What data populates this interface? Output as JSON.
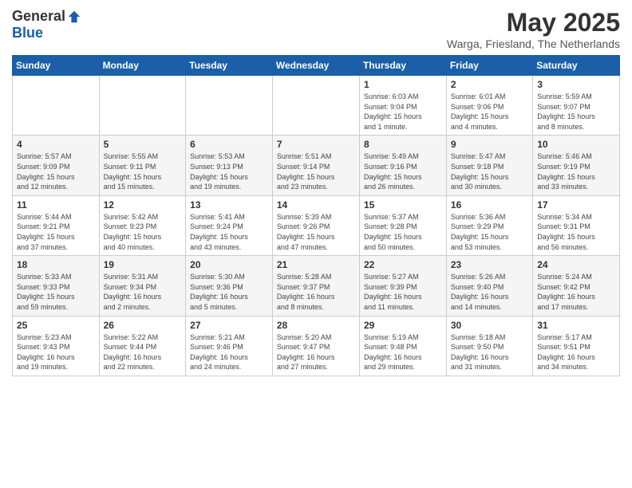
{
  "logo": {
    "general": "General",
    "blue": "Blue"
  },
  "title": "May 2025",
  "location": "Warga, Friesland, The Netherlands",
  "days_header": [
    "Sunday",
    "Monday",
    "Tuesday",
    "Wednesday",
    "Thursday",
    "Friday",
    "Saturday"
  ],
  "weeks": [
    [
      {
        "day": "",
        "info": ""
      },
      {
        "day": "",
        "info": ""
      },
      {
        "day": "",
        "info": ""
      },
      {
        "day": "",
        "info": ""
      },
      {
        "day": "1",
        "info": "Sunrise: 6:03 AM\nSunset: 9:04 PM\nDaylight: 15 hours\nand 1 minute."
      },
      {
        "day": "2",
        "info": "Sunrise: 6:01 AM\nSunset: 9:06 PM\nDaylight: 15 hours\nand 4 minutes."
      },
      {
        "day": "3",
        "info": "Sunrise: 5:59 AM\nSunset: 9:07 PM\nDaylight: 15 hours\nand 8 minutes."
      }
    ],
    [
      {
        "day": "4",
        "info": "Sunrise: 5:57 AM\nSunset: 9:09 PM\nDaylight: 15 hours\nand 12 minutes."
      },
      {
        "day": "5",
        "info": "Sunrise: 5:55 AM\nSunset: 9:11 PM\nDaylight: 15 hours\nand 15 minutes."
      },
      {
        "day": "6",
        "info": "Sunrise: 5:53 AM\nSunset: 9:13 PM\nDaylight: 15 hours\nand 19 minutes."
      },
      {
        "day": "7",
        "info": "Sunrise: 5:51 AM\nSunset: 9:14 PM\nDaylight: 15 hours\nand 23 minutes."
      },
      {
        "day": "8",
        "info": "Sunrise: 5:49 AM\nSunset: 9:16 PM\nDaylight: 15 hours\nand 26 minutes."
      },
      {
        "day": "9",
        "info": "Sunrise: 5:47 AM\nSunset: 9:18 PM\nDaylight: 15 hours\nand 30 minutes."
      },
      {
        "day": "10",
        "info": "Sunrise: 5:46 AM\nSunset: 9:19 PM\nDaylight: 15 hours\nand 33 minutes."
      }
    ],
    [
      {
        "day": "11",
        "info": "Sunrise: 5:44 AM\nSunset: 9:21 PM\nDaylight: 15 hours\nand 37 minutes."
      },
      {
        "day": "12",
        "info": "Sunrise: 5:42 AM\nSunset: 9:23 PM\nDaylight: 15 hours\nand 40 minutes."
      },
      {
        "day": "13",
        "info": "Sunrise: 5:41 AM\nSunset: 9:24 PM\nDaylight: 15 hours\nand 43 minutes."
      },
      {
        "day": "14",
        "info": "Sunrise: 5:39 AM\nSunset: 9:26 PM\nDaylight: 15 hours\nand 47 minutes."
      },
      {
        "day": "15",
        "info": "Sunrise: 5:37 AM\nSunset: 9:28 PM\nDaylight: 15 hours\nand 50 minutes."
      },
      {
        "day": "16",
        "info": "Sunrise: 5:36 AM\nSunset: 9:29 PM\nDaylight: 15 hours\nand 53 minutes."
      },
      {
        "day": "17",
        "info": "Sunrise: 5:34 AM\nSunset: 9:31 PM\nDaylight: 15 hours\nand 56 minutes."
      }
    ],
    [
      {
        "day": "18",
        "info": "Sunrise: 5:33 AM\nSunset: 9:33 PM\nDaylight: 15 hours\nand 59 minutes."
      },
      {
        "day": "19",
        "info": "Sunrise: 5:31 AM\nSunset: 9:34 PM\nDaylight: 16 hours\nand 2 minutes."
      },
      {
        "day": "20",
        "info": "Sunrise: 5:30 AM\nSunset: 9:36 PM\nDaylight: 16 hours\nand 5 minutes."
      },
      {
        "day": "21",
        "info": "Sunrise: 5:28 AM\nSunset: 9:37 PM\nDaylight: 16 hours\nand 8 minutes."
      },
      {
        "day": "22",
        "info": "Sunrise: 5:27 AM\nSunset: 9:39 PM\nDaylight: 16 hours\nand 11 minutes."
      },
      {
        "day": "23",
        "info": "Sunrise: 5:26 AM\nSunset: 9:40 PM\nDaylight: 16 hours\nand 14 minutes."
      },
      {
        "day": "24",
        "info": "Sunrise: 5:24 AM\nSunset: 9:42 PM\nDaylight: 16 hours\nand 17 minutes."
      }
    ],
    [
      {
        "day": "25",
        "info": "Sunrise: 5:23 AM\nSunset: 9:43 PM\nDaylight: 16 hours\nand 19 minutes."
      },
      {
        "day": "26",
        "info": "Sunrise: 5:22 AM\nSunset: 9:44 PM\nDaylight: 16 hours\nand 22 minutes."
      },
      {
        "day": "27",
        "info": "Sunrise: 5:21 AM\nSunset: 9:46 PM\nDaylight: 16 hours\nand 24 minutes."
      },
      {
        "day": "28",
        "info": "Sunrise: 5:20 AM\nSunset: 9:47 PM\nDaylight: 16 hours\nand 27 minutes."
      },
      {
        "day": "29",
        "info": "Sunrise: 5:19 AM\nSunset: 9:48 PM\nDaylight: 16 hours\nand 29 minutes."
      },
      {
        "day": "30",
        "info": "Sunrise: 5:18 AM\nSunset: 9:50 PM\nDaylight: 16 hours\nand 31 minutes."
      },
      {
        "day": "31",
        "info": "Sunrise: 5:17 AM\nSunset: 9:51 PM\nDaylight: 16 hours\nand 34 minutes."
      }
    ]
  ]
}
